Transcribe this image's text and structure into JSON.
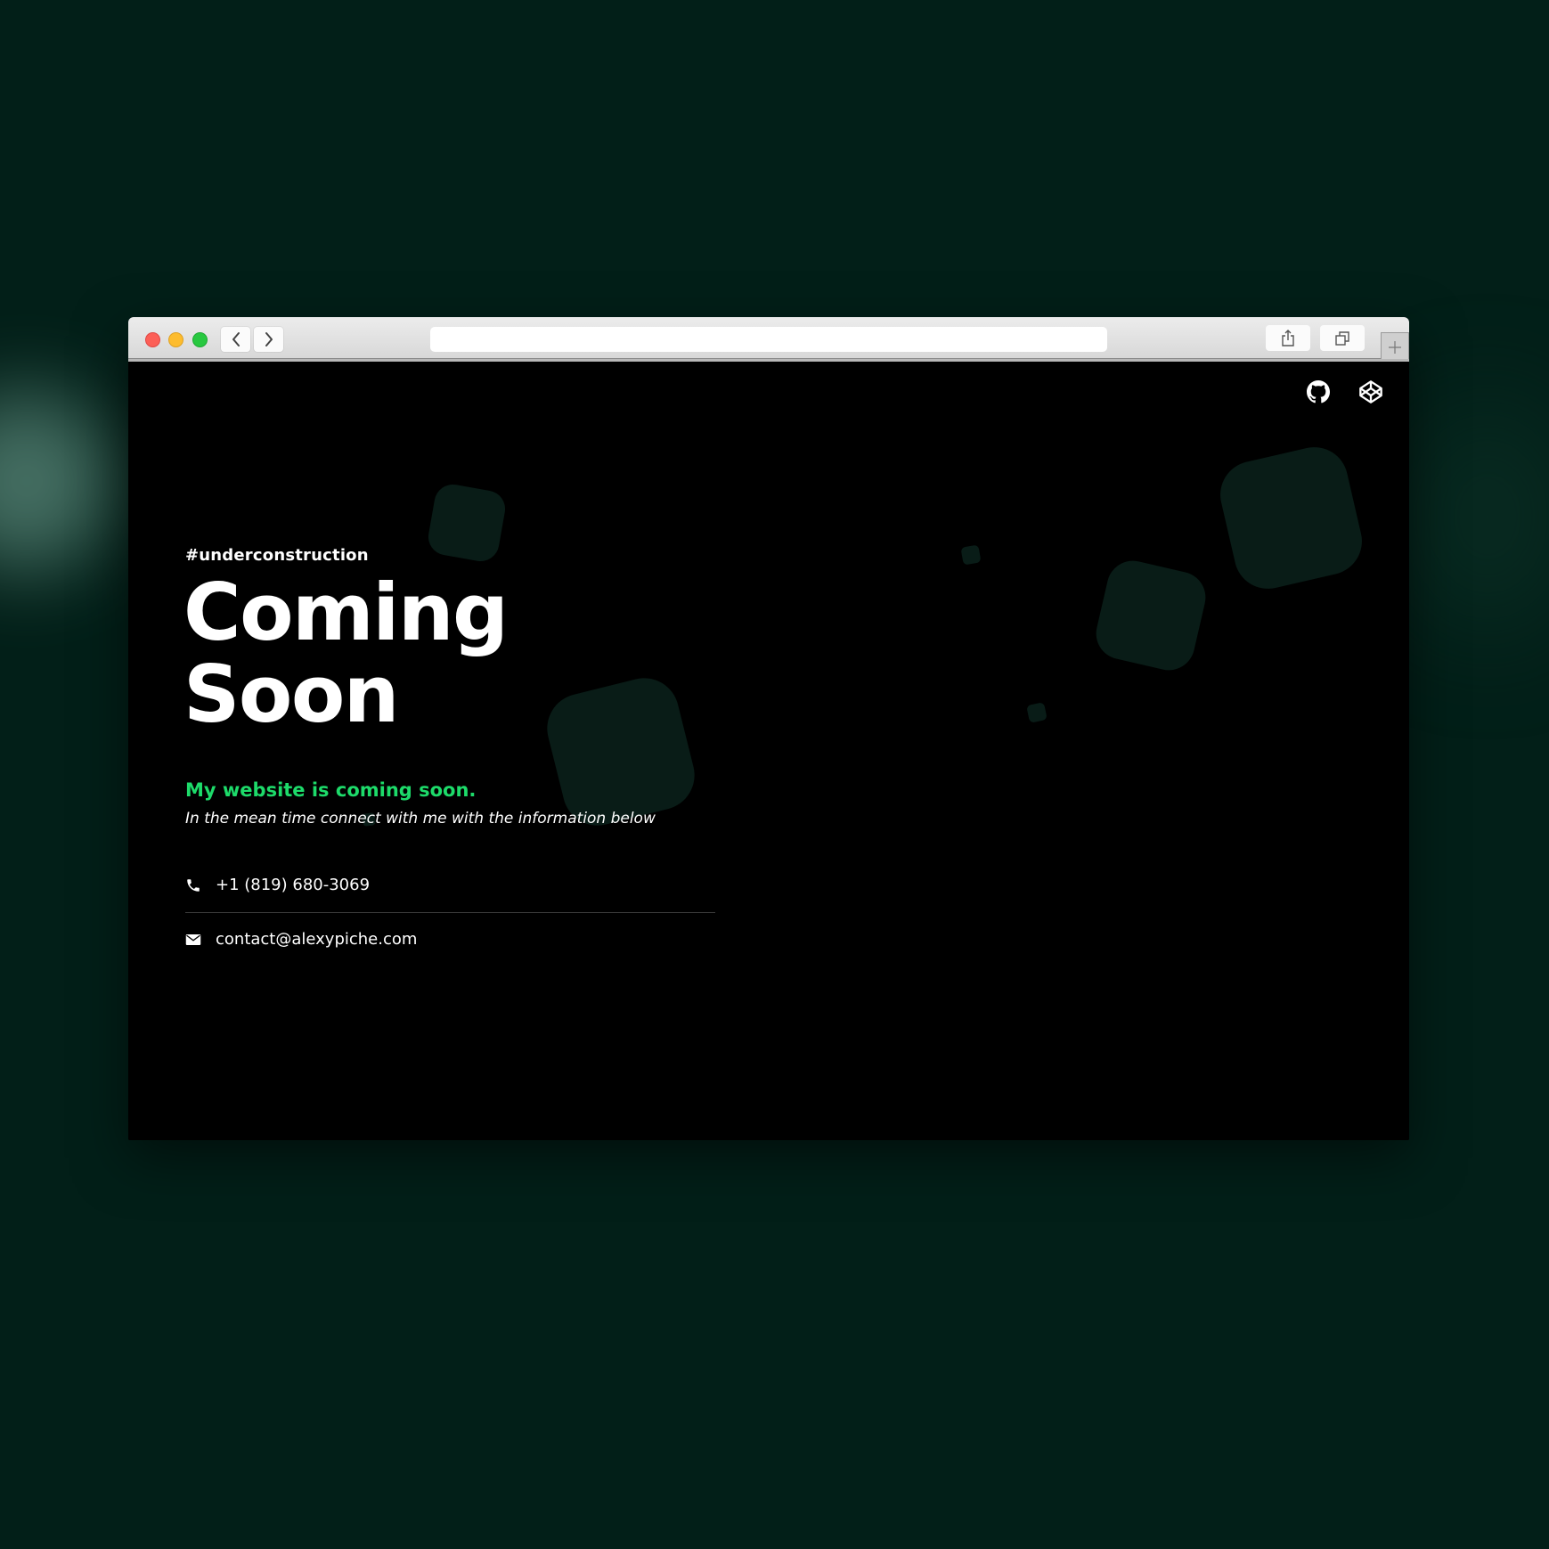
{
  "colors": {
    "backdrop": "#021f18",
    "page_background": "#000000",
    "accent_green": "#1ddb6a",
    "shape_tint": "#091c17"
  },
  "browser": {
    "traffic_lights": [
      "close",
      "minimize",
      "zoom"
    ],
    "nav_icons": [
      "chevron-left-icon",
      "chevron-right-icon"
    ],
    "toolbar_icons": [
      "share-icon",
      "tabs-overview-icon",
      "plus-icon"
    ],
    "address_value": ""
  },
  "header": {
    "social_icons": [
      "github-icon",
      "codepen-icon"
    ]
  },
  "hero": {
    "hashtag": "#underconstruction",
    "title": "Coming Soon",
    "subtitle": "My website is coming soon.",
    "description": "In the mean time connect with me with the information below"
  },
  "contact": {
    "phone": "+1 (819) 680-3069",
    "email": "contact@alexypiche.com"
  }
}
